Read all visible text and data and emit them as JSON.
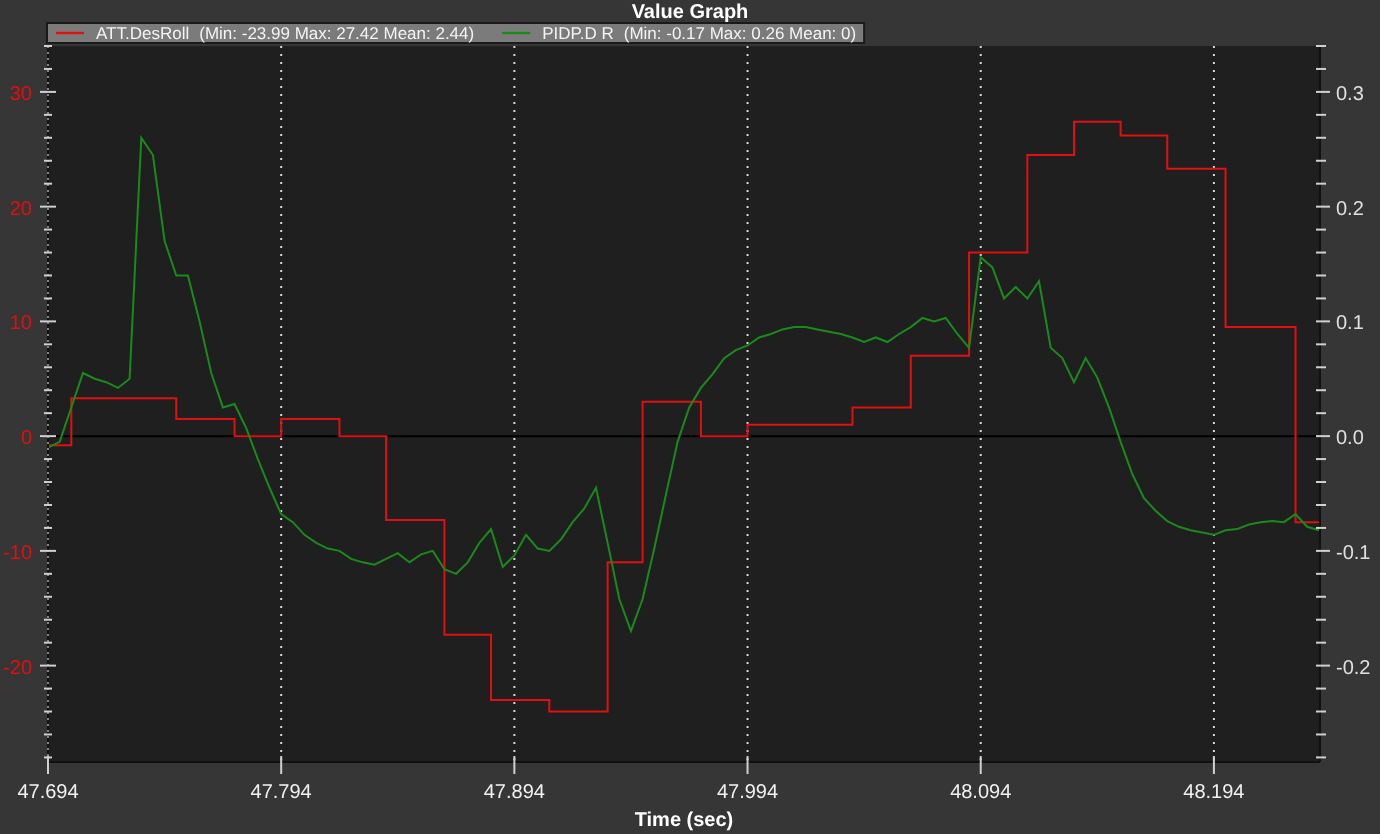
{
  "graph": {
    "legend": [
      {
        "stats": "(Min: -23.99 Max: 27.42 Mean: 2.44)"
      },
      {
        "stats": "(Min: -0.17 Max: 0.26 Mean: 0)"
      }
    ],
    "chart_data": {
      "type": "line",
      "title": "Value Graph",
      "xlabel": "Time (sec)",
      "grid": true,
      "legend": "top",
      "x": [
        47.694,
        47.699,
        47.704,
        47.704,
        47.709,
        47.714,
        47.719,
        47.724,
        47.729,
        47.734,
        47.739,
        47.744,
        47.749,
        47.749,
        47.754,
        47.759,
        47.764,
        47.769,
        47.774,
        47.774,
        47.779,
        47.784,
        47.789,
        47.794,
        47.794,
        47.799,
        47.804,
        47.809,
        47.814,
        47.819,
        47.819,
        47.824,
        47.829,
        47.834,
        47.839,
        47.839,
        47.844,
        47.849,
        47.854,
        47.859,
        47.864,
        47.864,
        47.869,
        47.874,
        47.879,
        47.884,
        47.884,
        47.889,
        47.894,
        47.899,
        47.904,
        47.909,
        47.909,
        47.914,
        47.919,
        47.924,
        47.929,
        47.934,
        47.934,
        47.939,
        47.944,
        47.949,
        47.949,
        47.954,
        47.959,
        47.964,
        47.969,
        47.974,
        47.974,
        47.979,
        47.984,
        47.989,
        47.994,
        47.994,
        47.999,
        48.004,
        48.009,
        48.014,
        48.019,
        48.024,
        48.029,
        48.034,
        48.039,
        48.039,
        48.044,
        48.049,
        48.054,
        48.059,
        48.064,
        48.064,
        48.069,
        48.074,
        48.079,
        48.084,
        48.089,
        48.089,
        48.094,
        48.099,
        48.104,
        48.109,
        48.114,
        48.114,
        48.119,
        48.124,
        48.129,
        48.134,
        48.134,
        48.139,
        48.144,
        48.149,
        48.154,
        48.154,
        48.159,
        48.164,
        48.169,
        48.174,
        48.174,
        48.179,
        48.184,
        48.189,
        48.194,
        48.199,
        48.199,
        48.204,
        48.209,
        48.214,
        48.219,
        48.224,
        48.229,
        48.229,
        48.234,
        48.239
      ],
      "series": [
        {
          "name": "ATT.DesRoll",
          "color": "#e01010",
          "values": [
            -0.8,
            -0.8,
            -0.8,
            3.3,
            3.3,
            3.3,
            3.3,
            3.3,
            3.3,
            3.3,
            3.3,
            3.3,
            3.3,
            1.5,
            1.5,
            1.5,
            1.5,
            1.5,
            1.5,
            0,
            0,
            0,
            0,
            0,
            1.5,
            1.5,
            1.5,
            1.5,
            1.5,
            1.5,
            0,
            0,
            0,
            0,
            0,
            -7.3,
            -7.3,
            -7.3,
            -7.3,
            -7.3,
            -7.3,
            -17.3,
            -17.3,
            -17.3,
            -17.3,
            -17.3,
            -23,
            -23,
            -23,
            -23,
            -23,
            -23,
            -24,
            -24,
            -24,
            -24,
            -24,
            -24,
            -11,
            -11,
            -11,
            -11,
            3,
            3,
            3,
            3,
            3,
            3,
            0,
            0,
            0,
            0,
            0,
            1,
            1,
            1,
            1,
            1,
            1,
            1,
            1,
            1,
            1,
            2.5,
            2.5,
            2.5,
            2.5,
            2.5,
            2.5,
            7,
            7,
            7,
            7,
            7,
            7,
            16,
            16,
            16,
            16,
            16,
            16,
            24.5,
            24.5,
            24.5,
            24.5,
            24.5,
            27.4,
            27.4,
            27.4,
            27.4,
            27.4,
            26.2,
            26.2,
            26.2,
            26.2,
            26.2,
            23.3,
            23.3,
            23.3,
            23.3,
            23.3,
            23.3,
            9.5,
            9.5,
            9.5,
            9.5,
            9.5,
            9.5,
            9.5,
            -7.5,
            -7.5,
            -7.5
          ]
        },
        {
          "name": "PIDP.D R",
          "color": "#1a8a1a",
          "axis": "y2",
          "values": [
            -0.01,
            -0.005,
            0.025,
            0.025,
            0.055,
            0.05,
            0.047,
            0.042,
            0.05,
            0.26,
            0.245,
            0.17,
            0.14,
            0.14,
            0.14,
            0.1,
            0.055,
            0.025,
            0.028,
            0.028,
            0.007,
            -0.02,
            -0.045,
            -0.068,
            -0.068,
            -0.075,
            -0.086,
            -0.093,
            -0.098,
            -0.1,
            -0.1,
            -0.107,
            -0.11,
            -0.112,
            -0.107,
            -0.107,
            -0.102,
            -0.11,
            -0.103,
            -0.1,
            -0.116,
            -0.116,
            -0.12,
            -0.11,
            -0.093,
            -0.081,
            -0.081,
            -0.114,
            -0.104,
            -0.086,
            -0.098,
            -0.1,
            -0.1,
            -0.09,
            -0.075,
            -0.063,
            -0.045,
            -0.093,
            -0.093,
            -0.142,
            -0.17,
            -0.142,
            -0.142,
            -0.098,
            -0.051,
            -0.005,
            0.025,
            0.042,
            0.042,
            0.054,
            0.068,
            0.075,
            0.079,
            0.079,
            0.086,
            0.089,
            0.093,
            0.095,
            0.095,
            0.093,
            0.091,
            0.089,
            0.086,
            0.086,
            0.082,
            0.086,
            0.082,
            0.089,
            0.095,
            0.095,
            0.103,
            0.1,
            0.103,
            0.089,
            0.077,
            0.077,
            0.156,
            0.147,
            0.12,
            0.13,
            0.12,
            0.12,
            0.135,
            0.077,
            0.068,
            0.047,
            0.047,
            0.068,
            0.051,
            0.025,
            -0.005,
            -0.005,
            -0.033,
            -0.054,
            -0.065,
            -0.074,
            -0.074,
            -0.079,
            -0.082,
            -0.084,
            -0.086,
            -0.082,
            -0.082,
            -0.081,
            -0.077,
            -0.075,
            -0.074,
            -0.075,
            -0.068,
            -0.068,
            -0.079,
            -0.082
          ]
        }
      ],
      "xlim": [
        47.694,
        48.2395
      ],
      "xticks": [
        {
          "value": 47.694,
          "label": "47.694"
        },
        {
          "value": 47.794,
          "label": "47.794"
        },
        {
          "value": 47.894,
          "label": "47.894"
        },
        {
          "value": 47.994,
          "label": "47.994"
        },
        {
          "value": 48.094,
          "label": "48.094"
        },
        {
          "value": 48.194,
          "label": "48.194"
        }
      ],
      "ylim": [
        -28.4,
        34
      ],
      "yticks": [
        -20,
        -10,
        0,
        10,
        20,
        30
      ],
      "y2lim": [
        -0.284,
        0.34
      ],
      "y2ticks": [
        {
          "value": -0.2,
          "label": "-0.2"
        },
        {
          "value": -0.1,
          "label": "-0.1"
        },
        {
          "value": 0,
          "label": "0.0"
        },
        {
          "value": 0.1,
          "label": "0.1"
        },
        {
          "value": 0.2,
          "label": "0.2"
        },
        {
          "value": 0.3,
          "label": "0.3"
        }
      ]
    }
  }
}
